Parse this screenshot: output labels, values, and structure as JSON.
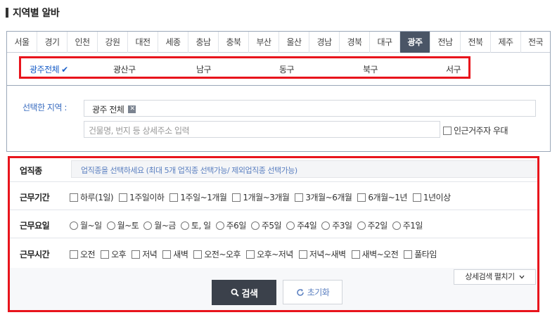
{
  "page": {
    "title": "지역별 알바"
  },
  "regions": {
    "tabs": [
      "서울",
      "경기",
      "인천",
      "강원",
      "대전",
      "세종",
      "충남",
      "충북",
      "부산",
      "울산",
      "경남",
      "경북",
      "대구",
      "광주",
      "전남",
      "전북",
      "제주",
      "전국"
    ],
    "active_tab": "광주",
    "subregions": [
      "광주전체",
      "광산구",
      "남구",
      "동구",
      "북구",
      "서구"
    ],
    "active_subregion": "광주전체"
  },
  "selection": {
    "label": "선택한 지역 :",
    "chip": "광주 전체",
    "chip_remove": "✕",
    "address_placeholder": "건물명, 번지 등 상세주소 입력",
    "nearby_label": "인근거주자 우대"
  },
  "filters": {
    "job": {
      "label": "업직종",
      "placeholder": "업직종을 선택하세요 (최대 5개 업직종 선택가능/ 제외업직종 선택가능)"
    },
    "period": {
      "label": "근무기간",
      "options": [
        "하루(1일)",
        "1주일이하",
        "1주일~1개월",
        "1개월~3개월",
        "3개월~6개월",
        "6개월~1년",
        "1년이상"
      ]
    },
    "days": {
      "label": "근무요일",
      "options": [
        "월~일",
        "월~토",
        "월~금",
        "토, 일",
        "주6일",
        "주5일",
        "주4일",
        "주3일",
        "주2일",
        "주1일"
      ]
    },
    "time": {
      "label": "근무시간",
      "options": [
        "오전",
        "오후",
        "저녁",
        "새벽",
        "오전~오후",
        "오후~저녁",
        "저녁~새벽",
        "새벽~오전",
        "풀타임"
      ]
    }
  },
  "actions": {
    "detail_toggle": "상세검색 펼치기",
    "search": "검색",
    "reset": "초기화"
  },
  "colors": {
    "highlight_border": "#e8141c",
    "active_tab_bg": "#4a5566",
    "link_blue": "#1a5fc8"
  }
}
